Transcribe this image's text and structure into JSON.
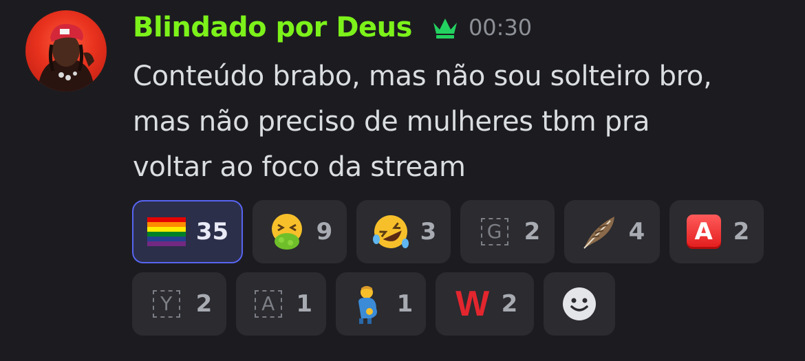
{
  "message": {
    "username": "Blindado por Deus",
    "timestamp": "00:30",
    "username_color": "#7cf21a",
    "crown_icon": "crown-icon",
    "lines": [
      "Conteúdo brabo, mas não sou solteiro bro,",
      "mas não preciso de mulheres tbm pra",
      "voltar ao foco da stream"
    ]
  },
  "reactions": [
    {
      "emoji": "🏳️‍🌈",
      "name": "rainbow-flag",
      "count": "35",
      "active": true
    },
    {
      "emoji": "🤮",
      "name": "vomiting-face",
      "count": "9"
    },
    {
      "emoji": "🤣",
      "name": "rolling-laughing-face",
      "count": "3"
    },
    {
      "emoji": "G",
      "name": "custom-emoji-g",
      "count": "2"
    },
    {
      "emoji": "🪶",
      "name": "feather",
      "count": "4"
    },
    {
      "emoji": "A",
      "name": "red-a-button",
      "count": "2"
    },
    {
      "emoji": "Y",
      "name": "custom-emoji-y",
      "count": "2"
    },
    {
      "emoji": "A",
      "name": "custom-emoji-a",
      "count": "1"
    },
    {
      "emoji": "🫃",
      "name": "pregnant-man",
      "count": "1"
    },
    {
      "emoji": "W",
      "name": "red-w",
      "count": "2"
    }
  ],
  "add_reaction_icon": "smiley-add-reaction-icon",
  "colors": {
    "background": "#1c1c20",
    "reaction_bg": "#2b2b30",
    "active_border": "#5865f2"
  }
}
